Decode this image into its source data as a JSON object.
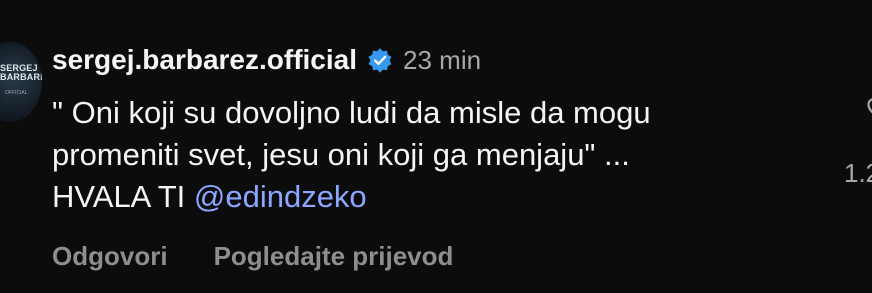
{
  "avatar": {
    "line1": "SERGEJ",
    "line2": "BARBAREZ",
    "line3": "OFFICIAL"
  },
  "comment": {
    "username": "sergej.barbarez.official",
    "time": "23 min",
    "text_line1": "\" Oni koji su dovoljno ludi da misle da mogu",
    "text_line2": "promeniti svet, jesu oni koji ga menjaju\" ...",
    "text_line3": "HVALA TI ",
    "mention": "@edindzeko"
  },
  "actions": {
    "reply": "Odgovori",
    "translate": "Pogledajte prijevod"
  },
  "likes": {
    "count": "1.2"
  },
  "colors": {
    "background": "#0c0c0d",
    "verified": "#3897f0",
    "mention": "#8ba7ff"
  },
  "icons": {
    "verified": "verified-badge-icon",
    "like": "heart-icon"
  }
}
